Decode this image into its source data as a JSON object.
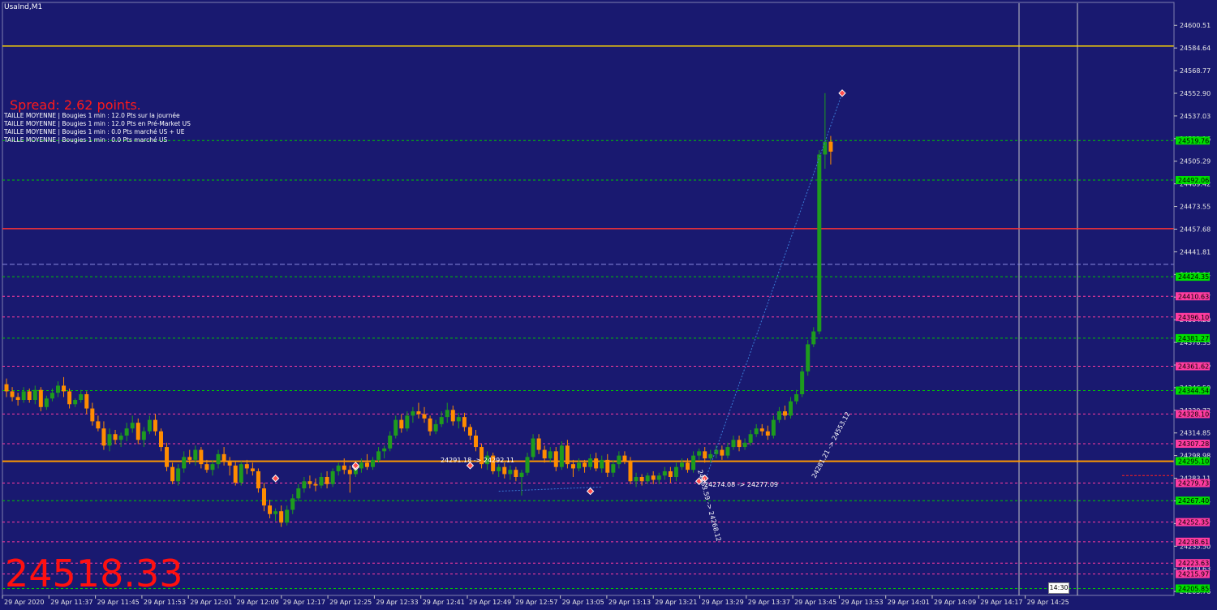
{
  "symbol": "UsaInd,M1",
  "spread": "Spread: 2.62 points.",
  "info_lines": [
    "TAILLE MOYENNE | Bougies 1 min : 12.0 Pts sur la journée",
    "TAILLE MOYENNE | Bougies 1 min : 12.0 Pts en Pré-Market US",
    "TAILLE MOYENNE | Bougies 1 min : 0.0 Pts marché US + UE",
    "TAILLE MOYENNE | Bougies 1 min : 0.0 Pts marché US"
  ],
  "big_price": "24518.33",
  "clock": "14:30",
  "colors": {
    "background": "#191970",
    "bull": "#1e9b1e",
    "bear": "#ff8c00",
    "green_level": "#00c800",
    "magenta_level": "#ff3ca0",
    "red_line": "#ff3333",
    "orange_line": "#ff9900",
    "yellow_line": "#ffd700"
  },
  "chart_data": {
    "type": "candlestick",
    "timeframe": "M1",
    "y_range": [
      24201,
      24616
    ],
    "x_labels": [
      "29 Apr 2020",
      "29 Apr 11:37",
      "29 Apr 11:45",
      "29 Apr 11:53",
      "29 Apr 12:01",
      "29 Apr 12:09",
      "29 Apr 12:17",
      "29 Apr 12:25",
      "29 Apr 12:33",
      "29 Apr 12:41",
      "29 Apr 12:49",
      "29 Apr 12:57",
      "29 Apr 13:05",
      "29 Apr 13:13",
      "29 Apr 13:21",
      "29 Apr 13:29",
      "29 Apr 13:37",
      "29 Apr 13:45",
      "29 Apr 13:53",
      "29 Apr 14:01",
      "29 Apr 14:09",
      "29 Apr 14:17",
      "29 Apr 14:25"
    ],
    "y_ticks": [
      "24600.51",
      "24584.64",
      "24568.77",
      "24552.90",
      "24537.03",
      "24521.16",
      "24505.29",
      "24489.42",
      "24473.55",
      "24457.68",
      "24441.81",
      "24425.94",
      "24410.07",
      "24394.20",
      "24378.33",
      "24362.46",
      "24346.59",
      "24330.72",
      "24314.85",
      "24298.98",
      "24283.11",
      "24267.24",
      "24251.37",
      "24235.50",
      "24219.63",
      "24203.76"
    ],
    "green_levels": [
      "24519.76",
      "24492.06",
      "24424.35",
      "24381.27",
      "24344.54",
      "24295.10",
      "24267.40",
      "24205.85"
    ],
    "magenta_levels": [
      "24410.63",
      "24396.10",
      "24361.62",
      "24328.10",
      "24307.28",
      "24279.73",
      "24252.35",
      "24238.61",
      "24223.63",
      "24215.97"
    ],
    "lines": {
      "yellow": 24586,
      "red": 24458,
      "dash_blue": 24433,
      "orange": 24295
    },
    "annotations": [
      {
        "text": "24291.18 -> 24292.11",
        "price": 24292
      },
      {
        "text": "24274.08 -> 24277.09",
        "price": 24276
      },
      {
        "text": "24263.59 -> 24268.12",
        "price": 24266
      },
      {
        "text": "24281.21 -> 24553.12",
        "price": 24282
      }
    ],
    "candles": [
      [
        24349,
        24353,
        24340,
        24344
      ],
      [
        24344,
        24347,
        24337,
        24340
      ],
      [
        24340,
        24343,
        24334,
        24338
      ],
      [
        24338,
        24347,
        24336,
        24344
      ],
      [
        24344,
        24346,
        24336,
        24338
      ],
      [
        24338,
        24348,
        24335,
        24345
      ],
      [
        24345,
        24347,
        24330,
        24333
      ],
      [
        24333,
        24341,
        24331,
        24339
      ],
      [
        24339,
        24346,
        24337,
        24343
      ],
      [
        24343,
        24351,
        24340,
        24348
      ],
      [
        24348,
        24354,
        24340,
        24344
      ],
      [
        24344,
        24346,
        24332,
        24335
      ],
      [
        24335,
        24339,
        24333,
        24338
      ],
      [
        24338,
        24345,
        24336,
        24342
      ],
      [
        24342,
        24344,
        24328,
        24332
      ],
      [
        24332,
        24336,
        24320,
        24323
      ],
      [
        24323,
        24327,
        24316,
        24318
      ],
      [
        24318,
        24323,
        24303,
        24306
      ],
      [
        24306,
        24318,
        24302,
        24314
      ],
      [
        24314,
        24317,
        24307,
        24310
      ],
      [
        24310,
        24315,
        24305,
        24313
      ],
      [
        24313,
        24322,
        24309,
        24318
      ],
      [
        24318,
        24327,
        24315,
        24322
      ],
      [
        24322,
        24325,
        24307,
        24310
      ],
      [
        24310,
        24319,
        24305,
        24316
      ],
      [
        24316,
        24327,
        24314,
        24324
      ],
      [
        24324,
        24328,
        24313,
        24316
      ],
      [
        24316,
        24318,
        24302,
        24305
      ],
      [
        24305,
        24308,
        24288,
        24291
      ],
      [
        24291,
        24294,
        24279,
        24281
      ],
      [
        24281,
        24293,
        24278,
        24290
      ],
      [
        24290,
        24302,
        24287,
        24298
      ],
      [
        24298,
        24303,
        24293,
        24296
      ],
      [
        24296,
        24306,
        24292,
        24303
      ],
      [
        24303,
        24305,
        24290,
        24293
      ],
      [
        24293,
        24296,
        24287,
        24289
      ],
      [
        24289,
        24296,
        24285,
        24293
      ],
      [
        24293,
        24303,
        24290,
        24300
      ],
      [
        24300,
        24305,
        24292,
        24295
      ],
      [
        24295,
        24298,
        24285,
        24292
      ],
      [
        24292,
        24295,
        24278,
        24280
      ],
      [
        24280,
        24295,
        24278,
        24293
      ],
      [
        24293,
        24296,
        24286,
        24290
      ],
      [
        24290,
        24294,
        24285,
        24288
      ],
      [
        24288,
        24290,
        24273,
        24276
      ],
      [
        24276,
        24280,
        24260,
        24264
      ],
      [
        24264,
        24268,
        24255,
        24258
      ],
      [
        24258,
        24262,
        24253,
        24260
      ],
      [
        24260,
        24264,
        24249,
        24252
      ],
      [
        24252,
        24264,
        24250,
        24261
      ],
      [
        24261,
        24272,
        24258,
        24269
      ],
      [
        24269,
        24279,
        24267,
        24276
      ],
      [
        24276,
        24284,
        24273,
        24281
      ],
      [
        24281,
        24285,
        24276,
        24279
      ],
      [
        24279,
        24283,
        24274,
        24278
      ],
      [
        24278,
        24287,
        24276,
        24284
      ],
      [
        24284,
        24288,
        24276,
        24279
      ],
      [
        24279,
        24290,
        24277,
        24288
      ],
      [
        24288,
        24294,
        24285,
        24292
      ],
      [
        24292,
        24297,
        24286,
        24289
      ],
      [
        24289,
        24292,
        24273,
        24286
      ],
      [
        24286,
        24294,
        24284,
        24290
      ],
      [
        24290,
        24297,
        24287,
        24294
      ],
      [
        24294,
        24300,
        24289,
        24291
      ],
      [
        24291,
        24298,
        24289,
        24296
      ],
      [
        24296,
        24305,
        24294,
        24302
      ],
      [
        24302,
        24306,
        24297,
        24304
      ],
      [
        24304,
        24316,
        24302,
        24313
      ],
      [
        24313,
        24327,
        24311,
        24324
      ],
      [
        24324,
        24328,
        24315,
        24318
      ],
      [
        24318,
        24330,
        24316,
        24327
      ],
      [
        24327,
        24333,
        24322,
        24330
      ],
      [
        24330,
        24336,
        24325,
        24328
      ],
      [
        24328,
        24333,
        24322,
        24325
      ],
      [
        24325,
        24327,
        24313,
        24316
      ],
      [
        24316,
        24324,
        24314,
        24321
      ],
      [
        24321,
        24330,
        24319,
        24326
      ],
      [
        24326,
        24336,
        24322,
        24331
      ],
      [
        24331,
        24334,
        24320,
        24323
      ],
      [
        24323,
        24329,
        24318,
        24326
      ],
      [
        24326,
        24329,
        24316,
        24319
      ],
      [
        24319,
        24321,
        24310,
        24313
      ],
      [
        24313,
        24317,
        24302,
        24305
      ],
      [
        24305,
        24307,
        24290,
        24293
      ],
      [
        24293,
        24302,
        24289,
        24299
      ],
      [
        24299,
        24301,
        24286,
        24288
      ],
      [
        24288,
        24293,
        24284,
        24291
      ],
      [
        24291,
        24294,
        24283,
        24286
      ],
      [
        24286,
        24292,
        24282,
        24289
      ],
      [
        24289,
        24291,
        24281,
        24284
      ],
      [
        24284,
        24289,
        24271,
        24287
      ],
      [
        24287,
        24301,
        24285,
        24298
      ],
      [
        24298,
        24314,
        24296,
        24311
      ],
      [
        24311,
        24314,
        24300,
        24303
      ],
      [
        24303,
        24306,
        24294,
        24297
      ],
      [
        24297,
        24305,
        24294,
        24302
      ],
      [
        24302,
        24305,
        24288,
        24291
      ],
      [
        24291,
        24309,
        24289,
        24306
      ],
      [
        24306,
        24310,
        24290,
        24293
      ],
      [
        24293,
        24296,
        24284,
        24290
      ],
      [
        24290,
        24297,
        24288,
        24294
      ],
      [
        24294,
        24296,
        24287,
        24291
      ],
      [
        24291,
        24300,
        24289,
        24297
      ],
      [
        24297,
        24301,
        24288,
        24290
      ],
      [
        24290,
        24299,
        24287,
        24296
      ],
      [
        24296,
        24300,
        24284,
        24287
      ],
      [
        24287,
        24296,
        24284,
        24293
      ],
      [
        24293,
        24302,
        24290,
        24299
      ],
      [
        24299,
        24302,
        24293,
        24295
      ],
      [
        24295,
        24298,
        24279,
        24281
      ],
      [
        24281,
        24287,
        24277,
        24284
      ],
      [
        24284,
        24286,
        24278,
        24281
      ],
      [
        24281,
        24287,
        24279,
        24285
      ],
      [
        24285,
        24288,
        24279,
        24282
      ],
      [
        24282,
        24287,
        24279,
        24285
      ],
      [
        24285,
        24291,
        24282,
        24288
      ],
      [
        24288,
        24291,
        24280,
        24284
      ],
      [
        24284,
        24294,
        24281,
        24291
      ],
      [
        24291,
        24297,
        24289,
        24294
      ],
      [
        24294,
        24297,
        24287,
        24289
      ],
      [
        24289,
        24302,
        24287,
        24299
      ],
      [
        24299,
        24304,
        24296,
        24302
      ],
      [
        24302,
        24305,
        24294,
        24297
      ],
      [
        24297,
        24303,
        24294,
        24300
      ],
      [
        24300,
        24306,
        24297,
        24303
      ],
      [
        24303,
        24306,
        24296,
        24299
      ],
      [
        24299,
        24308,
        24297,
        24305
      ],
      [
        24305,
        24313,
        24303,
        24310
      ],
      [
        24310,
        24313,
        24302,
        24305
      ],
      [
        24305,
        24311,
        24303,
        24308
      ],
      [
        24308,
        24317,
        24306,
        24314
      ],
      [
        24314,
        24321,
        24312,
        24318
      ],
      [
        24318,
        24321,
        24313,
        24316
      ],
      [
        24316,
        24320,
        24310,
        24313
      ],
      [
        24313,
        24327,
        24311,
        24324
      ],
      [
        24324,
        24333,
        24322,
        24330
      ],
      [
        24330,
        24334,
        24324,
        24327
      ],
      [
        24327,
        24340,
        24325,
        24337
      ],
      [
        24337,
        24345,
        24335,
        24342
      ],
      [
        24342,
        24361,
        24340,
        24358
      ],
      [
        24358,
        24380,
        24355,
        24377
      ],
      [
        24377,
        24389,
        24375,
        24386
      ],
      [
        24386,
        24513,
        24384,
        24510
      ],
      [
        24510,
        24553,
        24500,
        24519
      ],
      [
        24519,
        24523,
        24503,
        24512
      ]
    ]
  }
}
